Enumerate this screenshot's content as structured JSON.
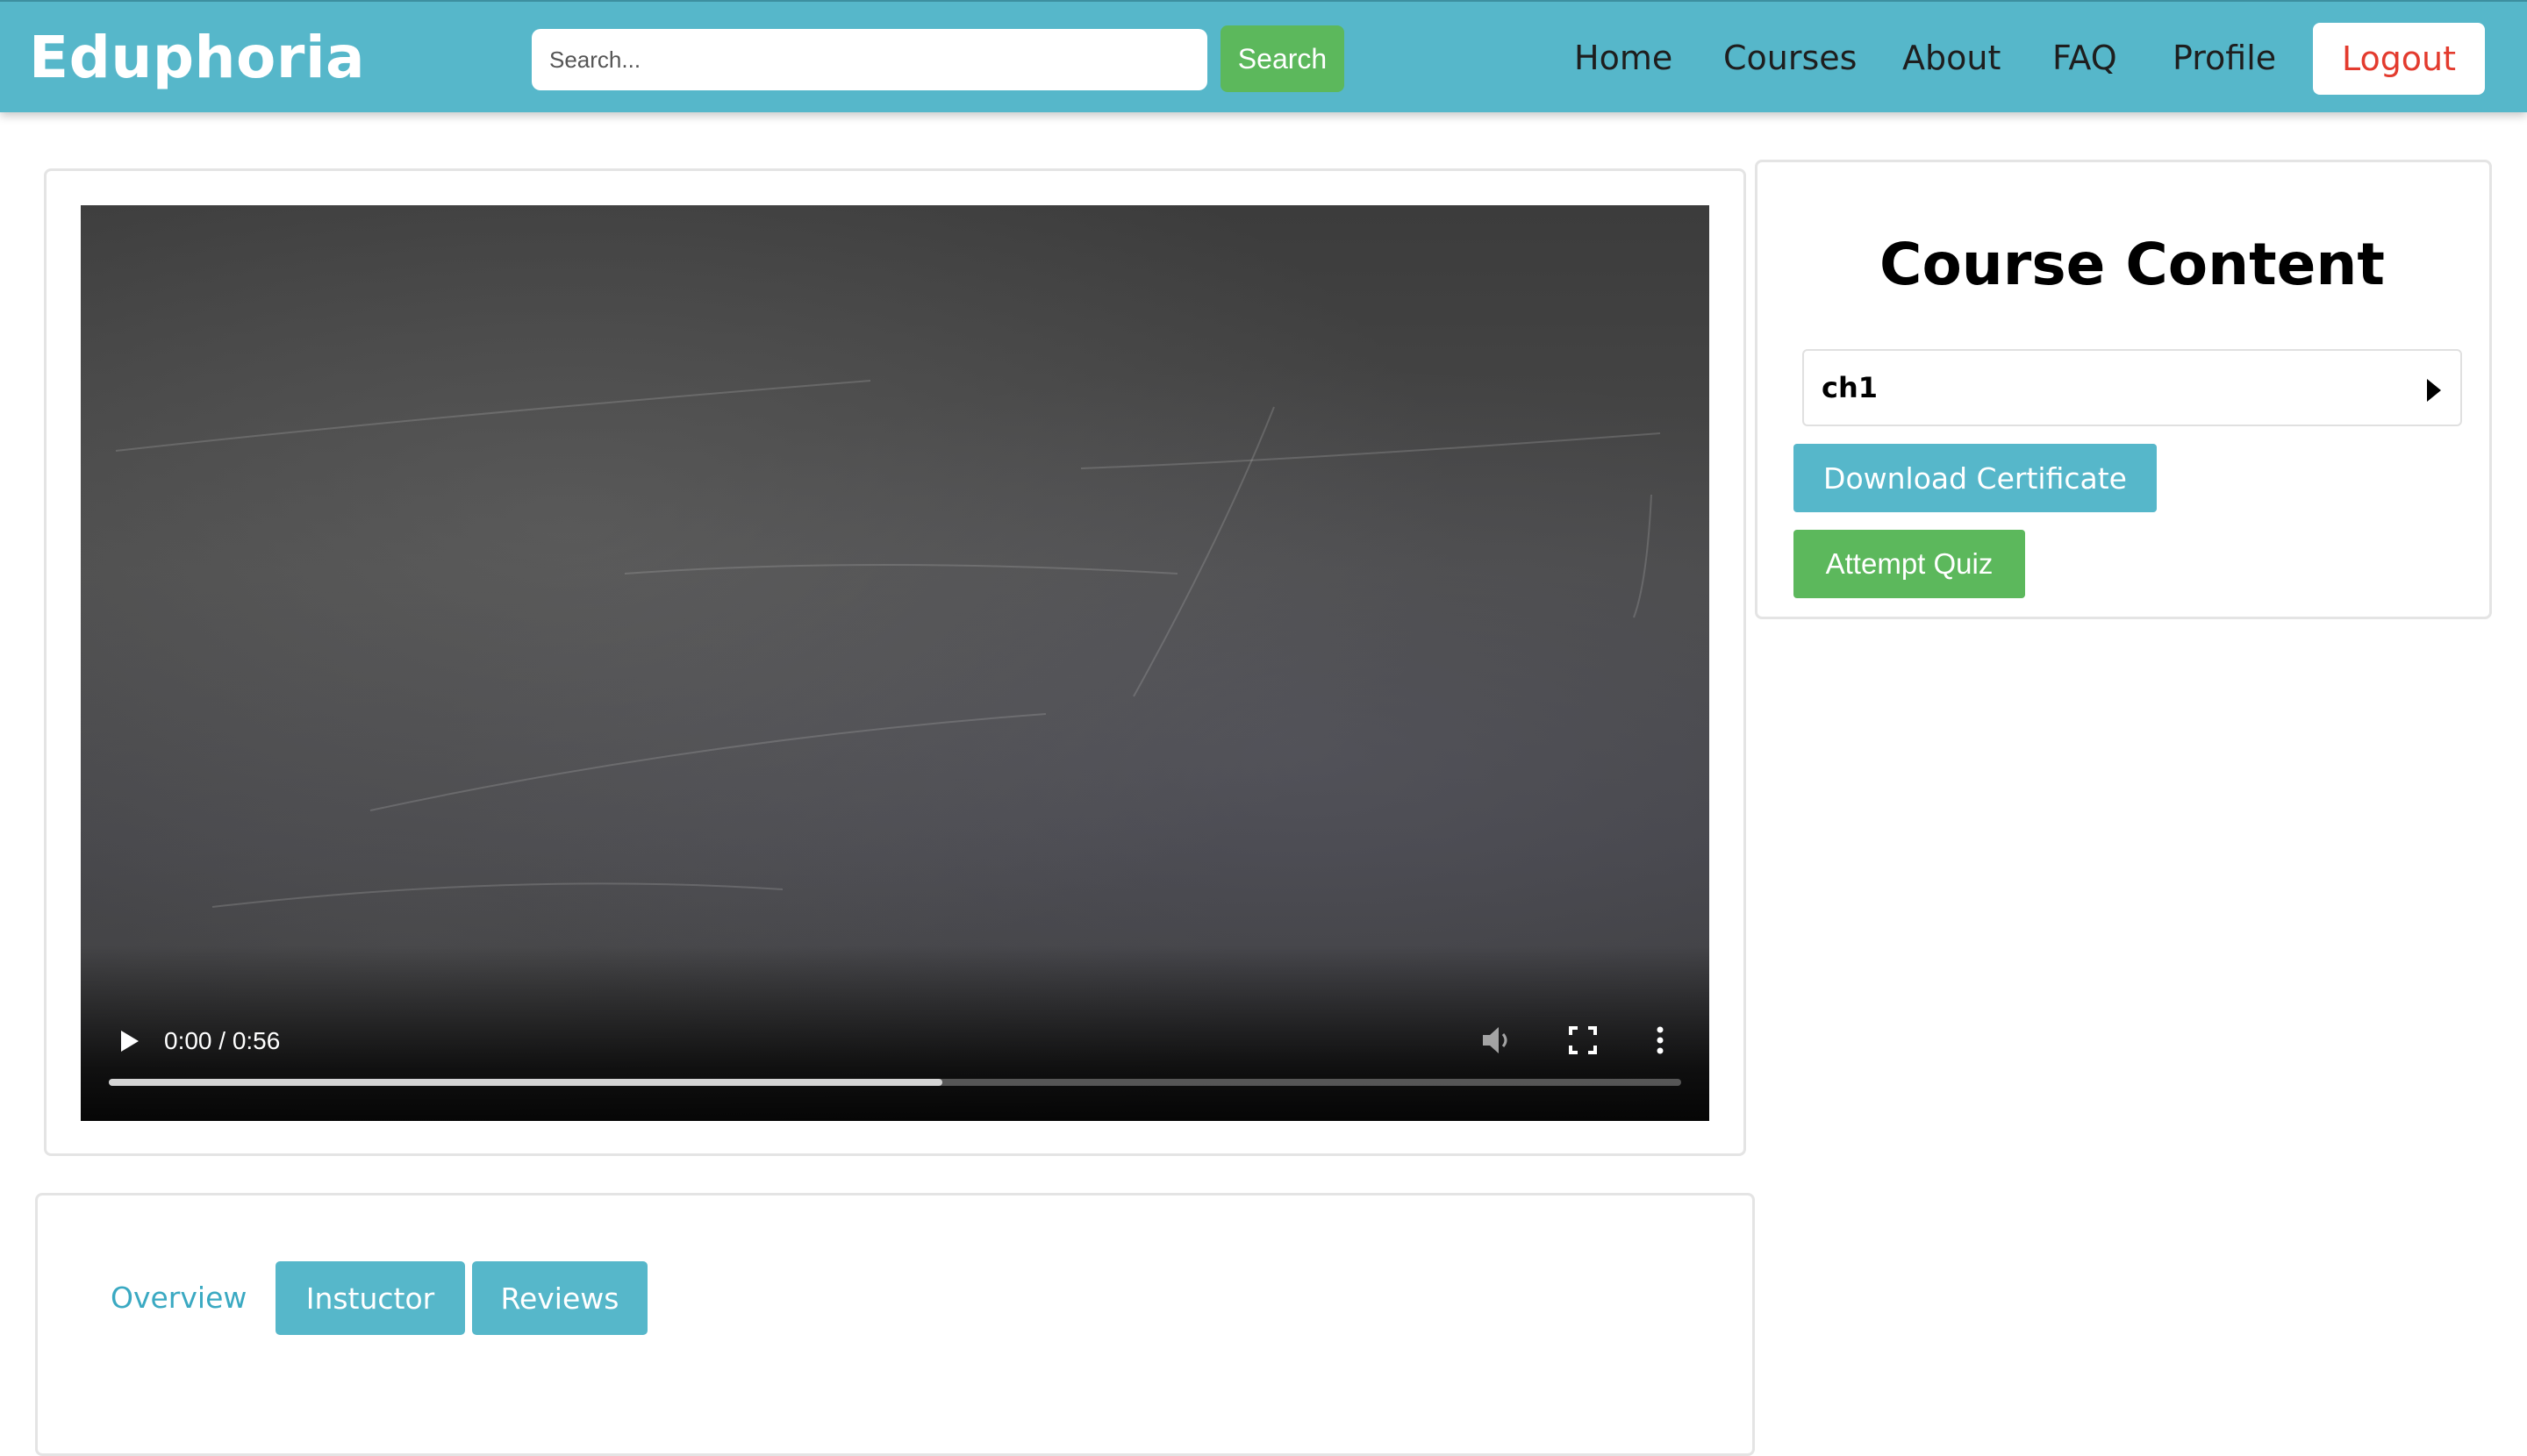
{
  "header": {
    "brand": "Eduphoria",
    "search_placeholder": "Search...",
    "search_button": "Search",
    "nav": [
      "Home",
      "Courses",
      "About",
      "FAQ",
      "Profile"
    ],
    "logout": "Logout",
    "colors": {
      "bar": "#56b7ca",
      "search_button": "#5cb85c",
      "logout_text": "#e33b2e"
    }
  },
  "video": {
    "time": "0:00 / 0:56",
    "buffered_fraction": 0.53,
    "icons": [
      "play-icon",
      "mute-icon",
      "fullscreen-icon",
      "more-vertical-icon"
    ]
  },
  "sidebar": {
    "title": "Course Content",
    "chapters": [
      {
        "label": "ch1"
      }
    ],
    "download_certificate": "Download Certificate",
    "attempt_quiz": "Attempt Quiz"
  },
  "tabs": {
    "items": [
      "Overview",
      "Instuctor",
      "Reviews"
    ],
    "active_color": "#3aa9c2"
  }
}
